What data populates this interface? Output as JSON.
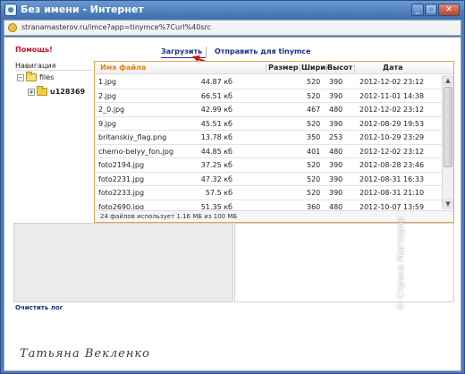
{
  "window": {
    "title": "Без имени - Интернет",
    "url": "stranamasterov.ru/imce?app=tinymce%7Curl%40src"
  },
  "toolbar": {
    "help_label": "Помощь!",
    "upload_tab": "Загрузить",
    "send_tab": "Отправить для tinymce"
  },
  "nav": {
    "header": "Навигация",
    "root_folder": "files",
    "child_folder": "u128369"
  },
  "file_table": {
    "columns": [
      "Имя файла",
      "Размер",
      "Ширин",
      "Высот",
      "Дата"
    ],
    "rows": [
      {
        "name": "1.jpg",
        "size": "44.87 кб",
        "width": "520",
        "height": "390",
        "date": "2012-12-02 23:12"
      },
      {
        "name": "2.jpg",
        "size": "66.51 кб",
        "width": "520",
        "height": "390",
        "date": "2012-11-01 14:38"
      },
      {
        "name": "2_0.jpg",
        "size": "42.99 кб",
        "width": "467",
        "height": "480",
        "date": "2012-12-02 23:12"
      },
      {
        "name": "9.jpg",
        "size": "45.51 кб",
        "width": "520",
        "height": "390",
        "date": "2012-08-29 19:53"
      },
      {
        "name": "britanskiy_flag.png",
        "size": "13.78 кб",
        "width": "350",
        "height": "253",
        "date": "2012-10-29 23:29"
      },
      {
        "name": "cherno-belyy_fon.jpg",
        "size": "44.85 кб",
        "width": "401",
        "height": "480",
        "date": "2012-12-02 23:12"
      },
      {
        "name": "foto2194.jpg",
        "size": "37.25 кб",
        "width": "520",
        "height": "390",
        "date": "2012-08-28 23:46"
      },
      {
        "name": "foto2231.jpg",
        "size": "47.32 кб",
        "width": "520",
        "height": "390",
        "date": "2012-08-31 16:33"
      },
      {
        "name": "foto2233.jpg",
        "size": "57.5 кб",
        "width": "520",
        "height": "390",
        "date": "2012-08-31 21:10"
      },
      {
        "name": "foto2690.jpg",
        "size": "51.35 кб",
        "width": "360",
        "height": "480",
        "date": "2012-10-07 13:59"
      }
    ],
    "status": "24 файлов использует 1.16 МБ из 100 МБ"
  },
  "footer": {
    "clear_log": "Очистить лог"
  },
  "signature": "Татьяна Векленко",
  "watermark": "© Страна Мастеров",
  "colors": {
    "accent_orange": "#e0821e",
    "link_blue": "#1d2f86",
    "help_red": "#c8102e",
    "arrow_red": "#d0101c"
  },
  "icons": {
    "window_icon": "ie-icon",
    "address_icon": "globe-icon",
    "folder_icon": "folder-icon",
    "arrow": "red-arrow-pointer"
  }
}
